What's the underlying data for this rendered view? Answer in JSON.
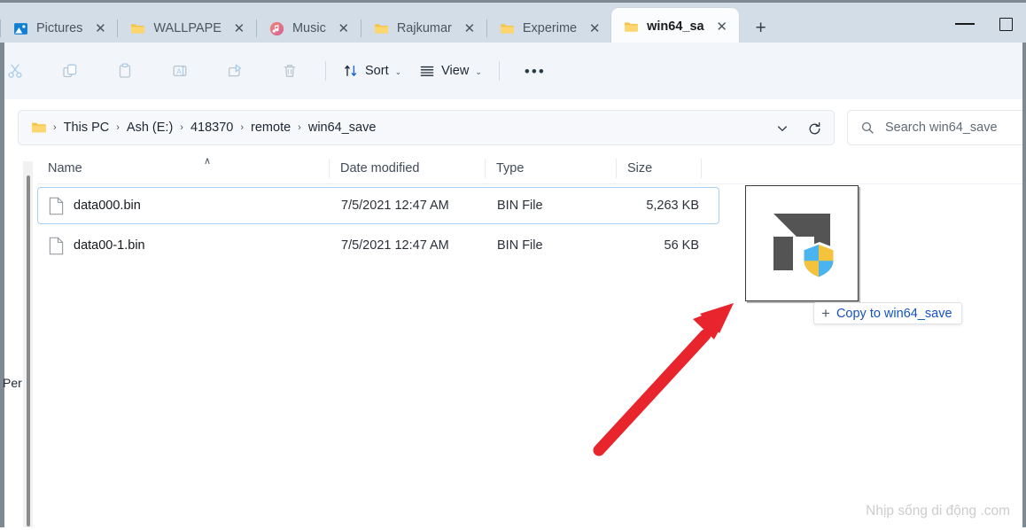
{
  "window": {
    "tabs": [
      {
        "label": "Pictures",
        "icon": "pictures-icon",
        "active": false,
        "close": "✕"
      },
      {
        "label": "WALLPAPE",
        "icon": "folder-icon",
        "active": false,
        "close": "✕"
      },
      {
        "label": "Music",
        "icon": "music-icon",
        "active": false,
        "close": "✕"
      },
      {
        "label": "Rajkumar",
        "icon": "folder-icon",
        "active": false,
        "close": "✕"
      },
      {
        "label": "Experime",
        "icon": "folder-icon",
        "active": false,
        "close": "✕"
      },
      {
        "label": "win64_sa",
        "icon": "folder-icon",
        "active": true,
        "close": "✕"
      }
    ],
    "new_tab_label": "+",
    "controls": {
      "minimize": "minimize",
      "maximize": "maximize"
    }
  },
  "toolbar": {
    "buttons": [
      {
        "name": "cut",
        "label": "Cut",
        "enabled": false
      },
      {
        "name": "copy",
        "label": "Copy",
        "enabled": false
      },
      {
        "name": "paste",
        "label": "Paste",
        "enabled": false
      },
      {
        "name": "rename",
        "label": "Rename",
        "enabled": false
      },
      {
        "name": "share",
        "label": "Share",
        "enabled": false
      },
      {
        "name": "delete",
        "label": "Delete",
        "enabled": false
      }
    ],
    "sort_label": "Sort",
    "view_label": "View",
    "more_label": "•••",
    "chevron": "⌄"
  },
  "addressbar": {
    "crumbs": [
      "This PC",
      "Ash (E:)",
      "418370",
      "remote",
      "win64_save"
    ],
    "separator": "›",
    "dropdown_label": "Previous locations",
    "refresh_label": "Refresh"
  },
  "search": {
    "placeholder": "Search win64_save",
    "icon": "search-icon"
  },
  "navpane": {
    "clipped_label": "Per"
  },
  "filelist": {
    "columns": [
      {
        "key": "name",
        "label": "Name",
        "sorted": "ascending",
        "caret": "∧"
      },
      {
        "key": "date",
        "label": "Date modified"
      },
      {
        "key": "type",
        "label": "Type"
      },
      {
        "key": "size",
        "label": "Size"
      }
    ],
    "rows": [
      {
        "name": "data000.bin",
        "date": "7/5/2021 12:47 AM",
        "type": "BIN File",
        "size": "5,263 KB",
        "selected": true,
        "icon": "file-icon"
      },
      {
        "name": "data00-1.bin",
        "date": "7/5/2021 12:47 AM",
        "type": "BIN File",
        "size": "56 KB",
        "selected": false,
        "icon": "file-icon"
      }
    ]
  },
  "drag": {
    "ghost_icon": "app-shield-icon",
    "drop_hint_plus": "+",
    "drop_hint_label": "Copy to win64_save"
  },
  "annotation": {
    "arrow_color": "#e8242c",
    "arrow_name": "red-pointer-arrow"
  },
  "watermark": {
    "text": "Nhịp sống di động .com"
  },
  "colors": {
    "titlebar": "#d3dde8",
    "commandbar": "#f2f6fa",
    "accent_link": "#1552c4",
    "selection_border": "#a8cff0"
  }
}
